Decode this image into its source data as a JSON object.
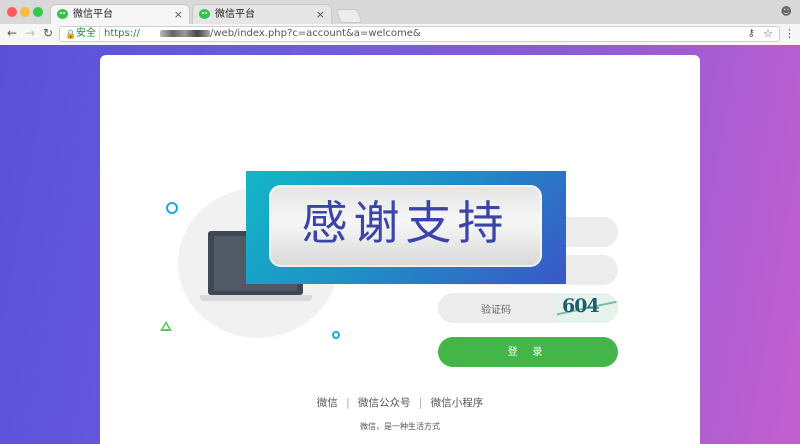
{
  "browser": {
    "tabs": [
      {
        "label": "微信平台"
      },
      {
        "label": "微信平台"
      }
    ],
    "tab_close": "×",
    "security_label": "安全",
    "url_scheme": "https",
    "url_protocol_display": "https://",
    "url_path": "/web/index.php?c=account&a=welcome&"
  },
  "login": {
    "captcha_placeholder": "验证码",
    "captcha_image_text": "604",
    "login_button": "登 录"
  },
  "footer": {
    "links": [
      "微信",
      "微信公众号",
      "微信小程序"
    ],
    "slogan": "微信，是一种生活方式"
  },
  "overlay": {
    "text": "感谢支持"
  },
  "colors": {
    "accent_green": "#44b549",
    "overlay_text": "#3b44a8"
  }
}
